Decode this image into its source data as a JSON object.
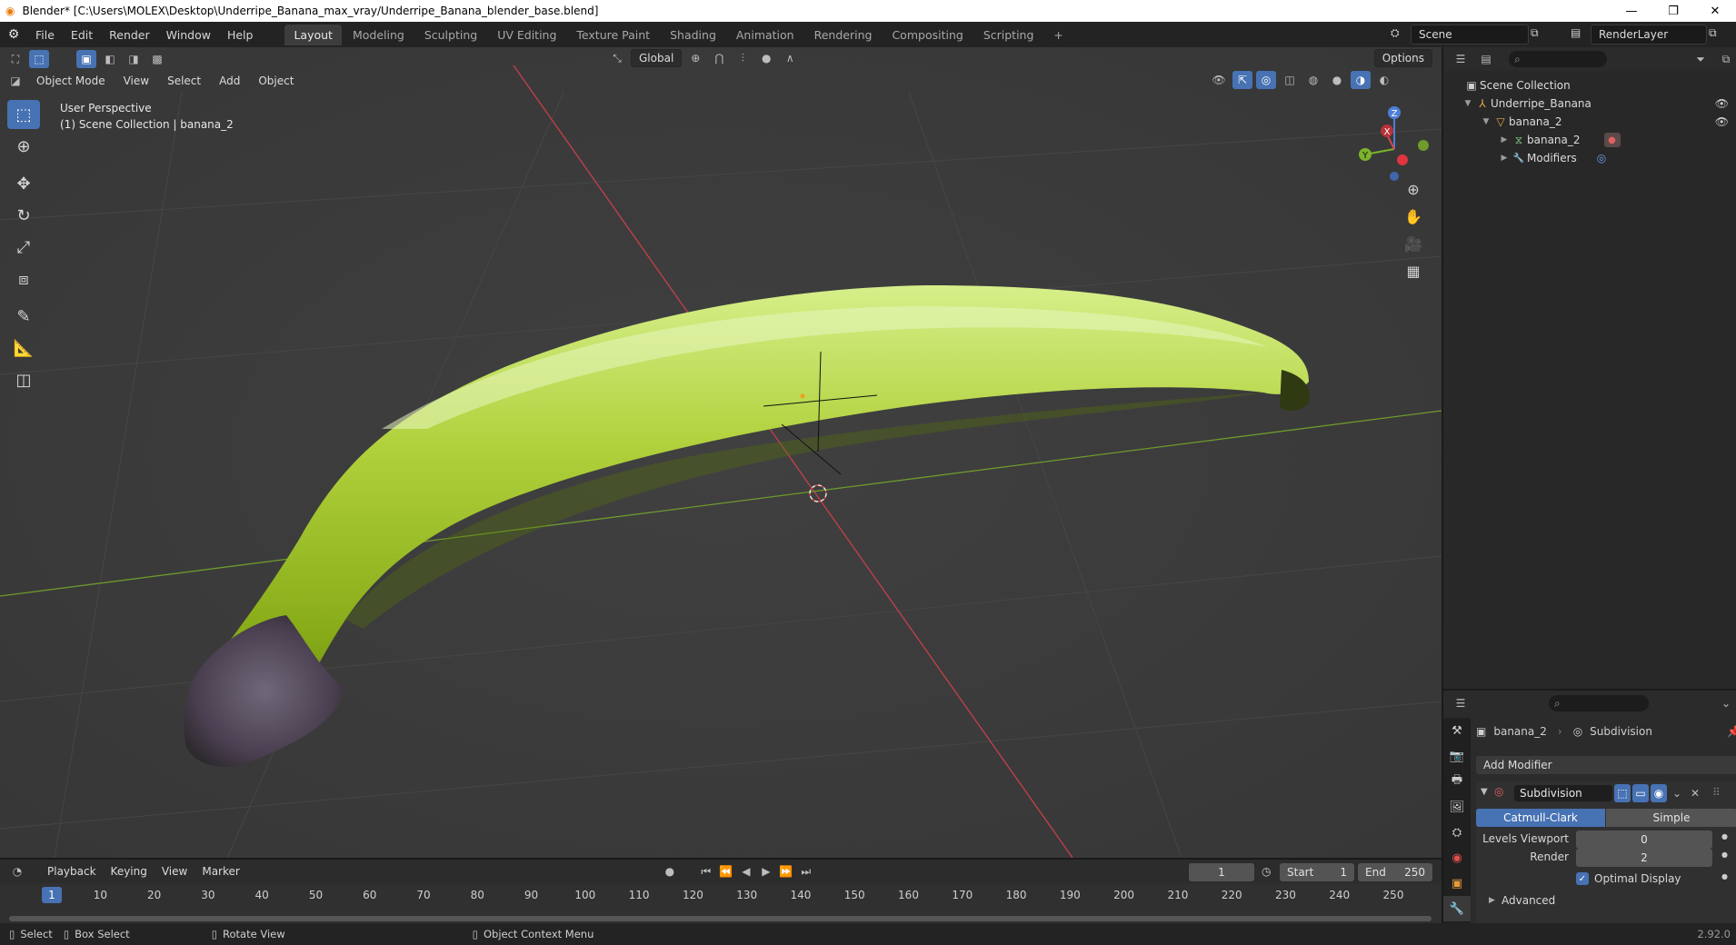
{
  "window": {
    "title": "Blender* [C:\\Users\\MOLEX\\Desktop\\Underripe_Banana_max_vray/Underripe_Banana_blender_base.blend]",
    "minimize": "—",
    "restore": "❐",
    "close": "✕"
  },
  "menu": [
    "File",
    "Edit",
    "Render",
    "Window",
    "Help"
  ],
  "workspaces": [
    "Layout",
    "Modeling",
    "Sculpting",
    "UV Editing",
    "Texture Paint",
    "Shading",
    "Animation",
    "Rendering",
    "Compositing",
    "Scripting"
  ],
  "active_workspace": "Layout",
  "add_workspace": "+",
  "scene": {
    "name": "Scene",
    "render_layer": "RenderLayer"
  },
  "viewport_header": {
    "transform_orientation": "Global",
    "options": "Options",
    "mode": "Object Mode",
    "menus": [
      "View",
      "Select",
      "Add",
      "Object"
    ]
  },
  "viewport": {
    "perspective": "User Perspective",
    "collection_info": "(1) Scene Collection | banana_2",
    "gizmo_axes": {
      "z": "Z",
      "y": "Y",
      "x": "X"
    }
  },
  "outliner": {
    "root": "Scene Collection",
    "items": [
      {
        "label": "Underripe_Banana",
        "icon": "⅄",
        "color": "#e4a94a"
      },
      {
        "label": "banana_2",
        "icon": "▽",
        "color": "#e4a94a"
      },
      {
        "label": "banana_2",
        "icon": "⧖",
        "color": "#7fd27f"
      },
      {
        "label": "Modifiers",
        "icon": "🔧",
        "color": "#6aa1e6"
      }
    ]
  },
  "properties": {
    "object_name": "banana_2",
    "modifier_crumb": "Subdivision",
    "add_modifier": "Add Modifier",
    "modifier_name": "Subdivision",
    "mode_a": "Catmull-Clark",
    "mode_b": "Simple",
    "levels_viewport_label": "Levels Viewport",
    "levels_viewport_value": "0",
    "render_label": "Render",
    "render_value": "2",
    "optimal_display": "Optimal Display",
    "advanced": "Advanced"
  },
  "timeline": {
    "menus": [
      "Playback",
      "Keying",
      "View",
      "Marker"
    ],
    "current_frame": "1",
    "start_label": "Start",
    "start_value": "1",
    "end_label": "End",
    "end_value": "250",
    "ticks": [
      "10",
      "20",
      "30",
      "40",
      "50",
      "60",
      "70",
      "80",
      "90",
      "100",
      "110",
      "120",
      "130",
      "140",
      "150",
      "160",
      "170",
      "180",
      "190",
      "200",
      "210",
      "220",
      "230",
      "240",
      "250"
    ],
    "playhead": "1"
  },
  "statusbar": {
    "select": "Select",
    "box_select": "Box Select",
    "rotate_view": "Rotate View",
    "context_menu": "Object Context Menu",
    "version": "2.92.0"
  },
  "colors": {
    "accent": "#4772b3",
    "x_axis": "#c5414a",
    "y_axis": "#6f9a2c",
    "banana": "#a3c732"
  }
}
